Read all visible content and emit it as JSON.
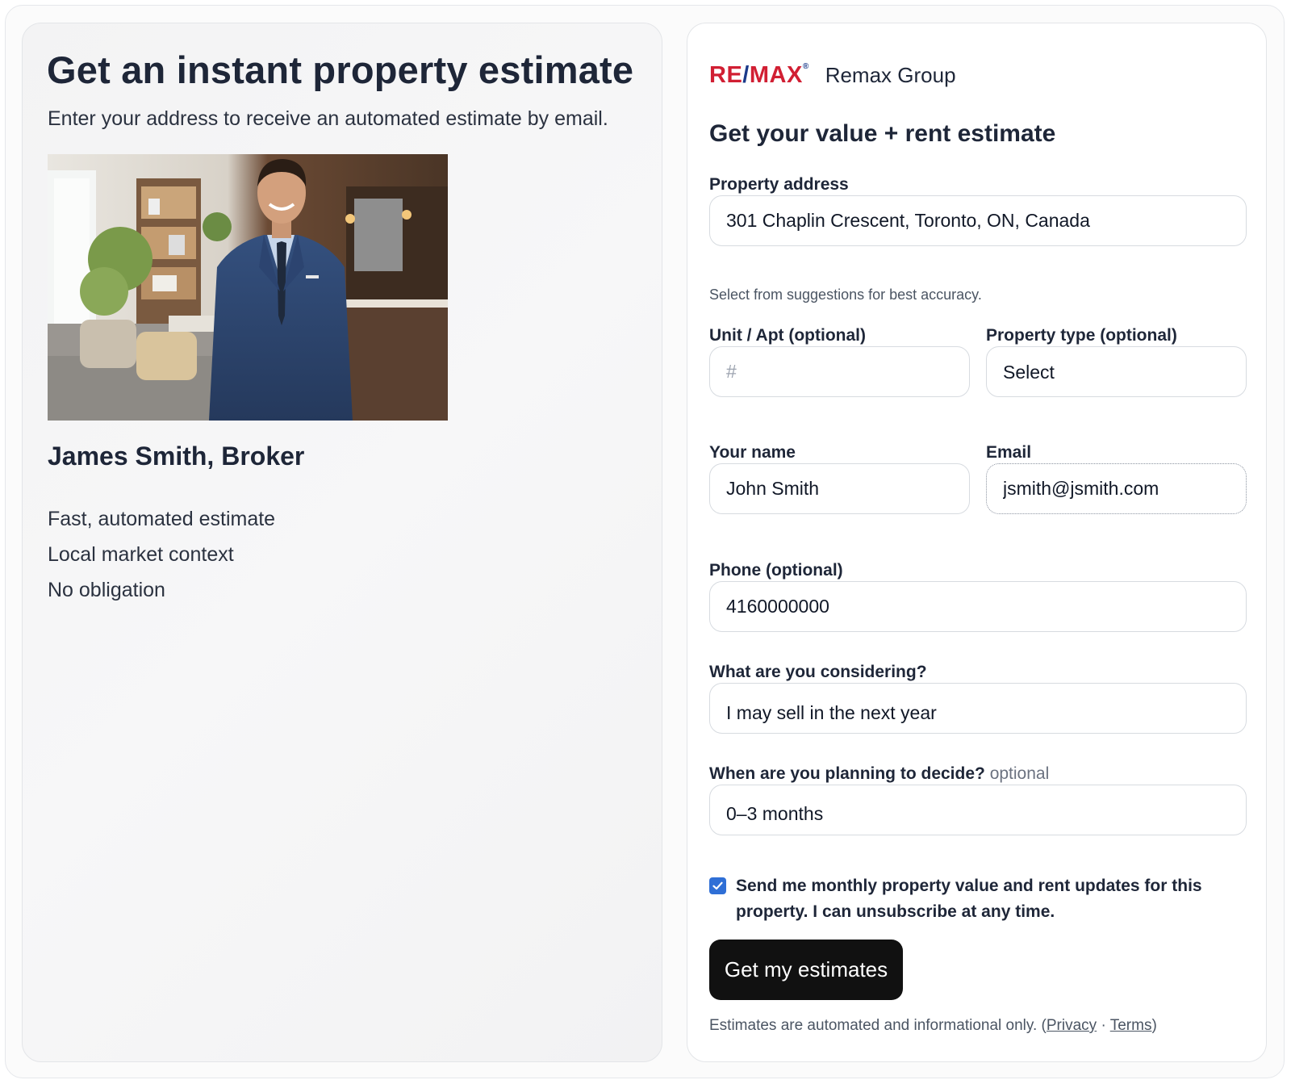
{
  "hero": {
    "title": "Get an instant property estimate",
    "subtitle": "Enter your address to receive an automated estimate by email."
  },
  "agent": {
    "name": "James Smith, Broker",
    "features": [
      "Fast, automated estimate",
      "Local market context",
      "No obligation"
    ]
  },
  "brand": {
    "logo_re": "RE",
    "logo_slash": "/",
    "logo_max": "MAX",
    "logo_tm": "®",
    "name": "Remax Group"
  },
  "form": {
    "title": "Get your value + rent estimate",
    "address": {
      "label": "Property address",
      "value": "301 Chaplin Crescent, Toronto, ON, Canada",
      "hint": "Select from suggestions for best accuracy."
    },
    "unit": {
      "label": "Unit / Apt (optional)",
      "placeholder": "#"
    },
    "property_type": {
      "label": "Property type (optional)",
      "value": "Select"
    },
    "name": {
      "label": "Your name",
      "value": "John Smith"
    },
    "email": {
      "label": "Email",
      "value": "jsmith@jsmith.com"
    },
    "phone": {
      "label": "Phone (optional)",
      "value": "4160000000"
    },
    "considering": {
      "label": "What are you considering?",
      "value": "I may sell in the next year"
    },
    "timeline": {
      "label": "When are you planning to decide?",
      "label_optional": "optional",
      "value": "0–3 months"
    },
    "consent": {
      "checked": true,
      "text": "Send me monthly property value and rent updates for this property. I can unsubscribe at any time."
    },
    "submit_label": "Get my estimates",
    "footer": {
      "text": "Estimates are automated and informational only. (",
      "privacy": "Privacy",
      "separator": " · ",
      "terms": "Terms",
      "close": ")"
    }
  },
  "colors": {
    "brand_red": "#d11f33",
    "brand_blue": "#1a3a8a",
    "checkbox": "#2f6fd6",
    "button": "#111111"
  }
}
